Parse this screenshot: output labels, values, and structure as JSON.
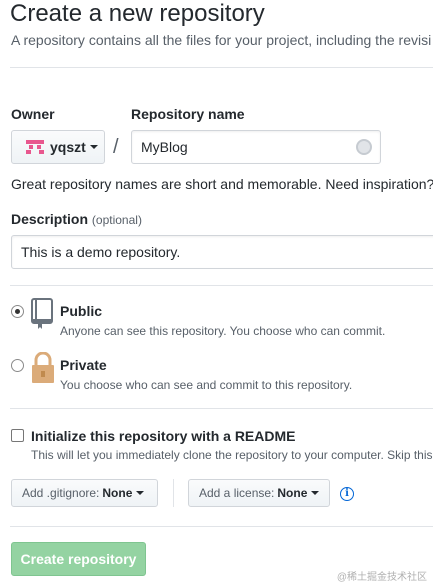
{
  "header": {
    "title": "Create a new repository",
    "subtitle": "A repository contains all the files for your project, including the revisi"
  },
  "owner": {
    "label": "Owner",
    "value": "yqszt",
    "avatar_color": "#e8578e"
  },
  "separator": "/",
  "repository": {
    "label": "Repository name",
    "value": "MyBlog",
    "hint": "Great repository names are short and memorable. Need inspiration?"
  },
  "description": {
    "label": "Description",
    "optional": "(optional)",
    "value": "This is a demo repository."
  },
  "visibility": {
    "public": {
      "title": "Public",
      "note": "Anyone can see this repository. You choose who can commit.",
      "checked": true
    },
    "private": {
      "title": "Private",
      "note": "You choose who can see and commit to this repository.",
      "checked": false
    }
  },
  "readme": {
    "title": "Initialize this repository with a README",
    "note": "This will let you immediately clone the repository to your computer. Skip this",
    "checked": false
  },
  "gitignore": {
    "prefix": "Add .gitignore:",
    "value": "None"
  },
  "license": {
    "prefix": "Add a license:",
    "value": "None"
  },
  "create_button": {
    "label": "Create repository",
    "color": "#94d3a2"
  },
  "watermark": "@稀土掘金技术社区"
}
